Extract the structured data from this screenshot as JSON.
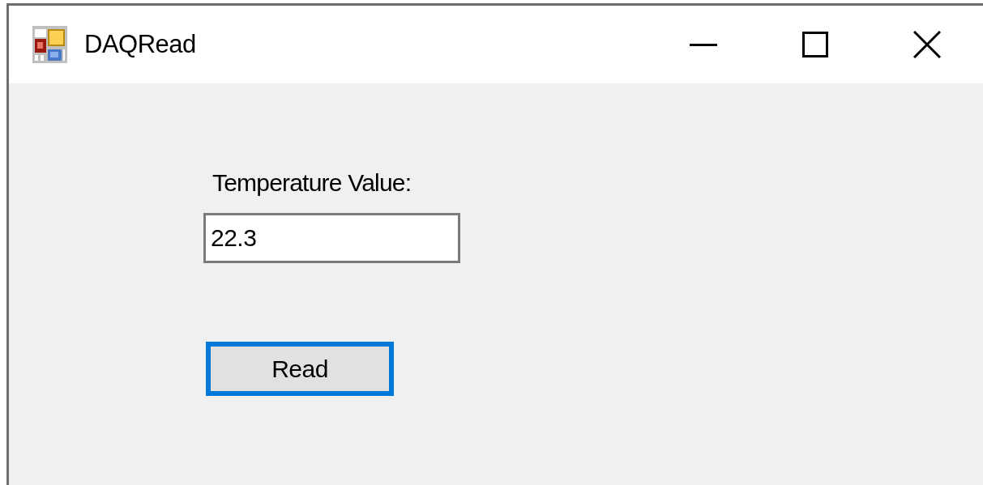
{
  "window": {
    "title": "DAQRead"
  },
  "temperature": {
    "label": "Temperature Value:",
    "value": "22.3"
  },
  "read_button": {
    "label": "Read",
    "focused": true
  }
}
